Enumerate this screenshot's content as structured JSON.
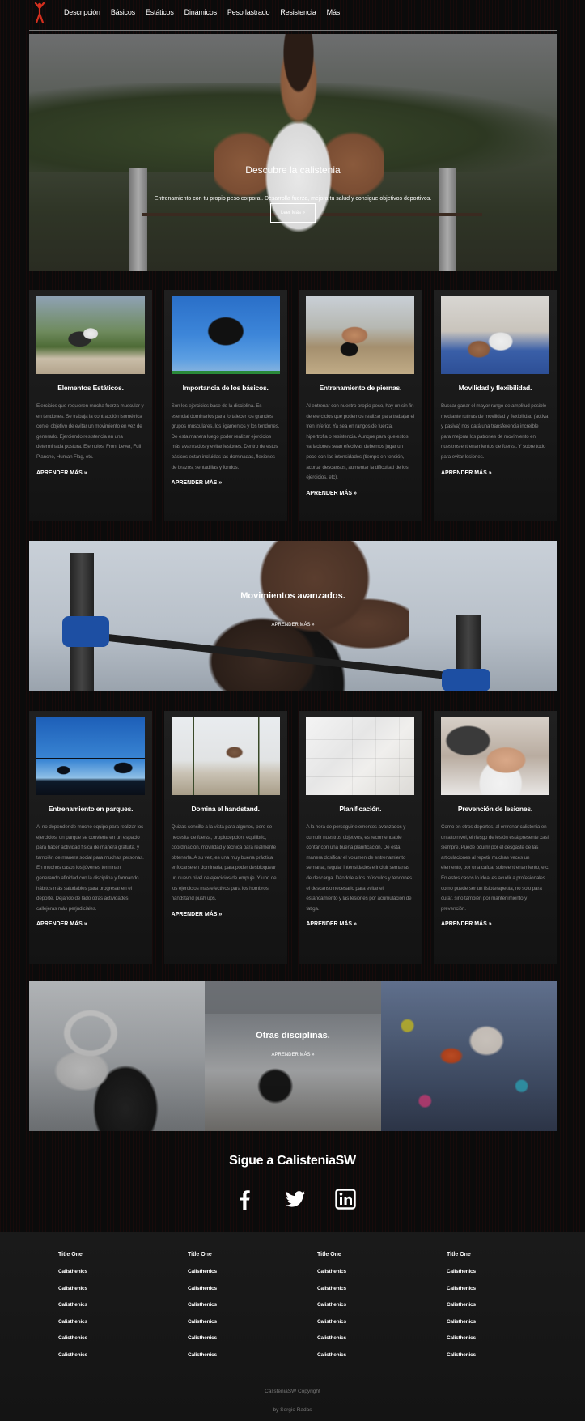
{
  "nav": {
    "items": [
      "Descripción",
      "Básicos",
      "Estáticos",
      "Dinámicos",
      "Peso lastrado",
      "Resistencia",
      "Más"
    ]
  },
  "hero": {
    "title": "Descubre la calistenia",
    "subtitle": "Entrenamiento con tu propio peso corporal. Desarrolla fuerza, mejora tu salud y consigue objetivos deportivos.",
    "button": "Leer Más »"
  },
  "cards_row1": [
    {
      "title": "Elementos Estáticos.",
      "text": "Ejercicios que requieren mucha fuerza muscular y en tendones. Se trabaja la contracción isométrica con el objetivo de evitar un movimiento en vez de generarlo. Ejerciendo resistencia en una determinada postura. Ejemplos: Front Lever, Full Planche, Human Flag, etc.",
      "link": "APRENDER MÁS »"
    },
    {
      "title": "Importancia de los básicos.",
      "text": "Son los ejercicios base de la disciplina. Es esencial dominarlos para fortalecer los grandes grupos musculares, los ligamentos y los tendones. De esta manera luego poder realizar ejercicios más avanzados y evitar lesiones. Dentro de estos básicos están incluidas las dominadas, flexiones de brazos, sentadillas y fondos.",
      "link": "APRENDER MÁS »"
    },
    {
      "title": "Entrenamiento de piernas.",
      "text": "Al entrenar con nuestro propio peso, hay un sin fin de ejercicios que podemos realizar para trabajar el tren inferior. Ya sea en rangos de fuerza, hipertrofia o resistencia. Aunque para que estos variaciones sean efectivas debemos jugar un poco con las intensidades (tiempo en tensión, acortar descansos, aumentar la dificultad de los ejercicios, etc).",
      "link": "APRENDER MÁS »"
    },
    {
      "title": "Movilidad y flexibilidad.",
      "text": "Buscar ganar el mayor rango de amplitud posible mediante rutinas de movilidad y flexibilidad (activa y pasiva) nos dará una transferencia increíble para mejorar los patrones de movimiento en nuestros entrenamientos de fuerza. Y sobre todo para evitar lesiones.",
      "link": "APRENDER MÁS »"
    }
  ],
  "banner2": {
    "title": "Movimientos avanzados.",
    "button": "APRENDER MÁS »"
  },
  "cards_row2": [
    {
      "title": "Entrenamiento en parques.",
      "text": "Al no depender de mucho equipo para realizar los ejercicios, un parque se convierte en un espacio para hacer actividad física de manera gratuita, y también de manera social para muchas personas. En muchos casos los jóvenes terminan generando afinidad con la disciplina y formando hábitos más saludables para progresar en el deporte. Dejando de lado otras actividades callejeras más perjudiciales.",
      "link": "APRENDER MÁS »"
    },
    {
      "title": "Domina el handstand.",
      "text": "Quizas sencillo a la vista para algunos, pero se necesita de fuerza, propiocepción, equilibrio, coordinación, movilidad y técnica para realmente obtenerla. A su vez, es una muy buena práctica enfocarse en dominarla, para poder desbloquear un nuevo nivel de ejercicios de empuje. Y uno de los ejercicios más efectivos para los hombros: handstand push ups.",
      "link": "APRENDER MÁS »"
    },
    {
      "title": "Planificación.",
      "text": "A la hora de perseguir elementos avanzados y cumplir nuestros objetivos, es recomendable contar con una buena planificación. De esta manera dosificar el volumen de entrenamiento semanal, regular intensidades e incluir semanas de descarga. Dándole a los músculos y tendones el descanso necesario para evitar el estancamiento y las lesiones por acumulación de fatiga.",
      "link": "APRENDER MÁS »"
    },
    {
      "title": "Prevención de lesiones.",
      "text": "Como en otros deportes, al entrenar calistenia en un alto nivel, el riesgo de lesión está presente casi siempre. Puede ocurrir por el desgaste de las articulaciones al repetir muchas veces un elemento, por una caída, sobreentrenamiento, etc. En estos casos lo ideal es acudir a profesionales como puede ser un fisioterapeuta, no solo para curar, sino también por mantenimiento y prevención.",
      "link": "APRENDER MÁS »"
    }
  ],
  "banner3": {
    "title": "Otras disciplinas.",
    "button": "APRENDER MÁS »"
  },
  "social": {
    "title": "Sigue a CalisteniaSW",
    "icons": [
      "facebook-icon",
      "twitter-icon",
      "linkedin-icon"
    ]
  },
  "footer": {
    "columns": [
      {
        "title": "Title One",
        "links": [
          "Calisthenics",
          "Calisthenics",
          "Calisthenics",
          "Calisthenics",
          "Calisthenics",
          "Calisthenics"
        ]
      },
      {
        "title": "Title One",
        "links": [
          "Calisthenics",
          "Calisthenics",
          "Calisthenics",
          "Calisthenics",
          "Calisthenics",
          "Calisthenics"
        ]
      },
      {
        "title": "Title One",
        "links": [
          "Calisthenics",
          "Calisthenics",
          "Calisthenics",
          "Calisthenics",
          "Calisthenics",
          "Calisthenics"
        ]
      },
      {
        "title": "Title One",
        "links": [
          "Calisthenics",
          "Calisthenics",
          "Calisthenics",
          "Calisthenics",
          "Calisthenics",
          "Calisthenics"
        ]
      }
    ],
    "copyright": "CalisteniaSW Copyright",
    "author": "by Sergio Radas"
  },
  "colors": {
    "background": "#0b0b0b",
    "card": "#1a1a1a",
    "logo": "#d32f1e",
    "muted_text": "#8a8a8a"
  }
}
